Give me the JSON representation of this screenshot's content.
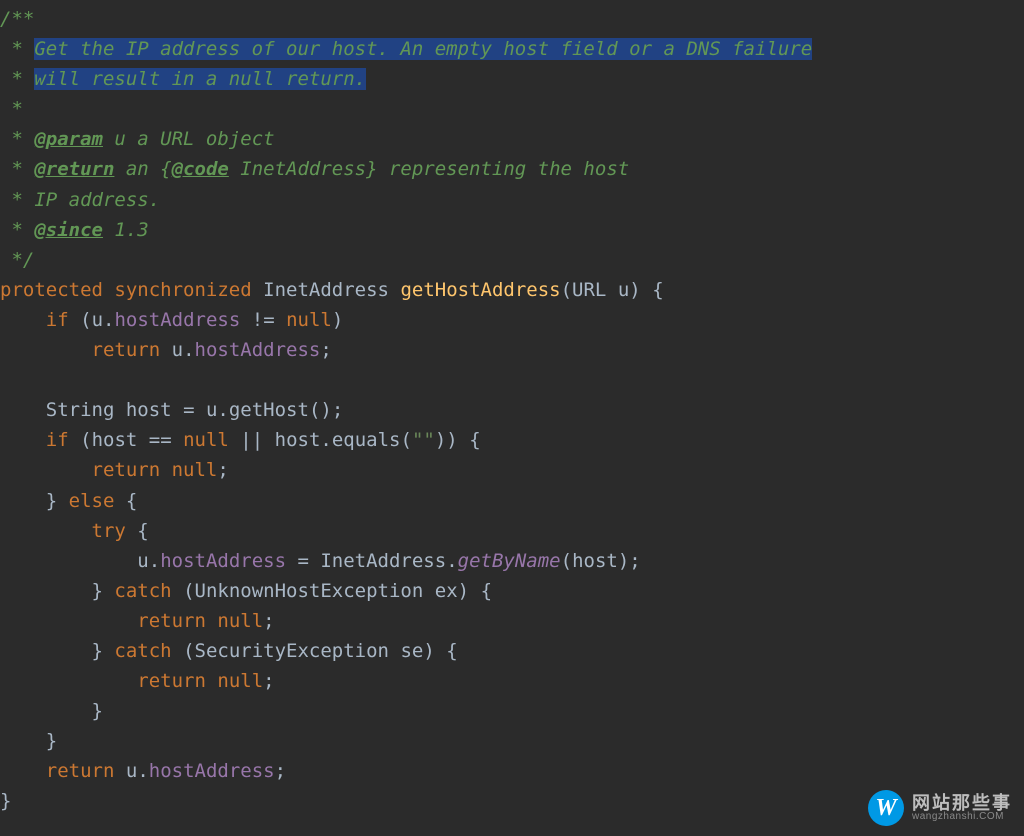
{
  "doc": {
    "open": "/**",
    "star": " *",
    "close": " */",
    "desc1": "Get the IP address of our host. An empty host field or a DNS failure",
    "desc2": "will result in a null return.",
    "tag_param": "@param",
    "param_rest": " u a URL object",
    "tag_return": "@return",
    "return_rest": " an {",
    "tag_code": "@code",
    "return_rest2": " InetAddress} representing the host",
    "ip_addr": " * IP address.",
    "tag_since": "@since",
    "since_rest": " 1.3"
  },
  "kw": {
    "protected": "protected",
    "synchronized": "synchronized",
    "if": "if",
    "return": "return",
    "null": "null",
    "else": "else",
    "try": "try",
    "catch": "catch"
  },
  "id": {
    "InetAddress": "InetAddress",
    "URL": "URL",
    "u": "u",
    "String": "String",
    "host": "host",
    "equals": "equals",
    "UnknownHostException": "UnknownHostException",
    "ex": "ex",
    "SecurityException": "SecurityException",
    "se": "se",
    "getHost": "getHost"
  },
  "method": {
    "getHostAddress": "getHostAddress",
    "getByName": "getByName"
  },
  "field": {
    "hostAddress": "hostAddress"
  },
  "str": {
    "empty": "\"\""
  },
  "sym": {
    "sp3": "  ",
    "lbrace": "{",
    "rbrace": "}",
    "lparen": "(",
    "rparen": ")",
    "semi": ";",
    "dot": ".",
    "comma": ", ",
    "neq": " != ",
    "eqeq": " == ",
    "or": " || ",
    "assign": " = "
  },
  "watermark": {
    "logo_letter": "W",
    "cn": "网站那些事",
    "en": "wangzhanshi.COM"
  }
}
